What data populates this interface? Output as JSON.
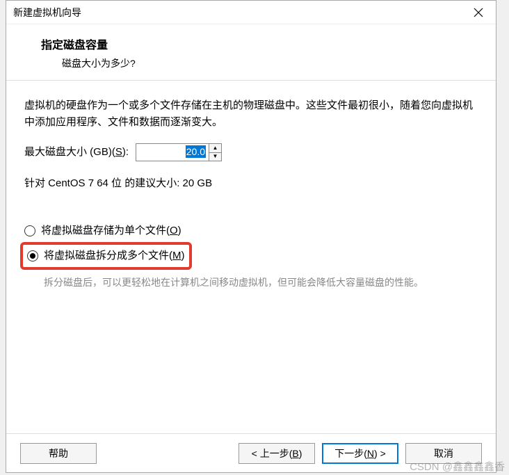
{
  "titlebar": {
    "title": "新建虚拟机向导"
  },
  "header": {
    "title": "指定磁盘容量",
    "subtitle": "磁盘大小为多少?"
  },
  "content": {
    "description": "虚拟机的硬盘作为一个或多个文件存储在主机的物理磁盘中。这些文件最初很小，随着您向虚拟机中添加应用程序、文件和数据而逐渐变大。",
    "size_label_prefix": "最大磁盘大小 (GB)(",
    "size_label_hotkey": "S",
    "size_label_suffix": "):",
    "size_value": "20.0",
    "recommend_text": "针对 CentOS 7 64 位 的建议大小: 20 GB",
    "radio1_prefix": "将虚拟磁盘存储为单个文件(",
    "radio1_hotkey": "O",
    "radio1_suffix": ")",
    "radio2_prefix": "将虚拟磁盘拆分成多个文件(",
    "radio2_hotkey": "M",
    "radio2_suffix": ")",
    "split_hint": "拆分磁盘后，可以更轻松地在计算机之间移动虚拟机，但可能会降低大容量磁盘的性能。"
  },
  "footer": {
    "help": "帮助",
    "back_prefix": "< 上一步(",
    "back_hotkey": "B",
    "back_suffix": ")",
    "next_prefix": "下一步(",
    "next_hotkey": "N",
    "next_suffix": ") >",
    "cancel": "取消"
  },
  "watermark": "CSDN @鑫鑫鑫鑫香"
}
